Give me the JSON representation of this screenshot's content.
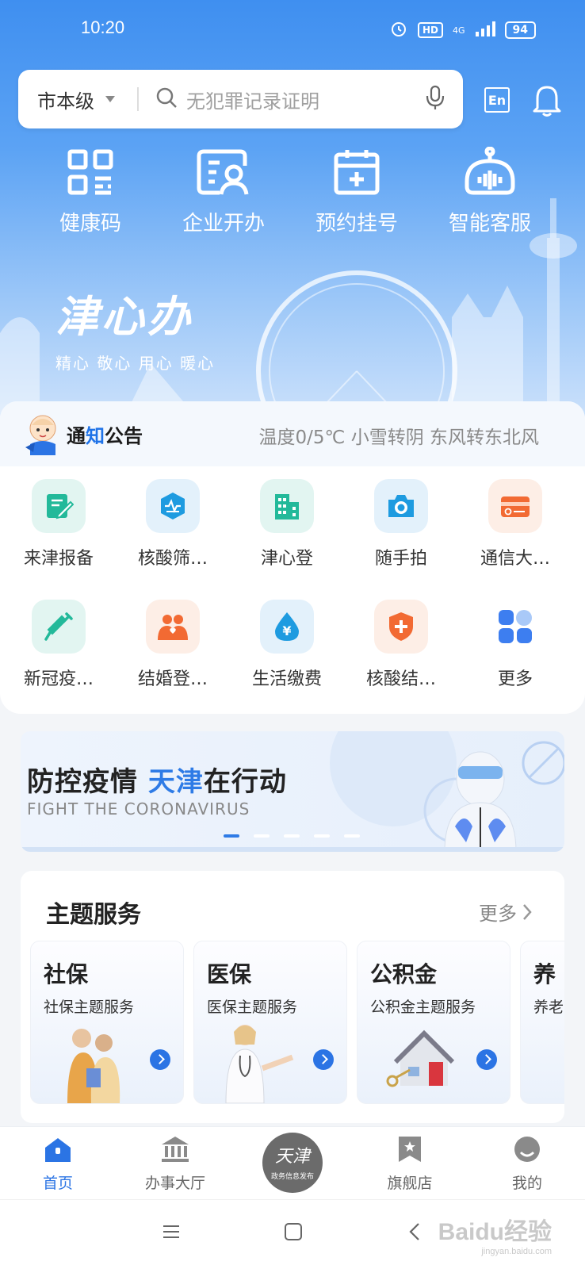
{
  "status_bar": {
    "time": "10:20",
    "hd": "HD",
    "network": "4G",
    "battery": "94"
  },
  "header": {
    "region": "市本级",
    "search_placeholder": "无犯罪记录证明",
    "lang_button": "En"
  },
  "quick_actions": [
    {
      "label": "健康码",
      "icon": "qr-code-icon"
    },
    {
      "label": "企业开办",
      "icon": "business-card-icon"
    },
    {
      "label": "预约挂号",
      "icon": "calendar-plus-icon"
    },
    {
      "label": "智能客服",
      "icon": "robot-icon"
    }
  ],
  "brand": {
    "logo": "津心办",
    "slogan": "精心 敬心 用心 暖心"
  },
  "notice": {
    "title_a": "通",
    "title_b": "知",
    "title_c": "公告",
    "weather": "温度0/5℃ 小雪转阴 东风转东北风"
  },
  "services": [
    {
      "label": "来津报备",
      "icon": "edit-form-icon",
      "bg": "#e2f5f1",
      "fg": "#23b99a"
    },
    {
      "label": "核酸筛…",
      "icon": "medical-test-icon",
      "bg": "#e3f1fb",
      "fg": "#1e9be0"
    },
    {
      "label": "津心登",
      "icon": "building-icon",
      "bg": "#e2f5f1",
      "fg": "#23b99a"
    },
    {
      "label": "随手拍",
      "icon": "camera-icon",
      "bg": "#e3f1fb",
      "fg": "#1e9be0"
    },
    {
      "label": "通信大…",
      "icon": "card-icon",
      "bg": "#fdeee6",
      "fg": "#f26a33"
    },
    {
      "label": "新冠疫…",
      "icon": "syringe-icon",
      "bg": "#e2f5f1",
      "fg": "#23b99a"
    },
    {
      "label": "结婚登…",
      "icon": "couple-icon",
      "bg": "#fdeee6",
      "fg": "#f26a33"
    },
    {
      "label": "生活缴费",
      "icon": "water-drop-yen-icon",
      "bg": "#e3f1fb",
      "fg": "#1e9be0"
    },
    {
      "label": "核酸结…",
      "icon": "shield-plus-icon",
      "bg": "#fdeee6",
      "fg": "#f26a33"
    },
    {
      "label": "更多",
      "icon": "grid-more-icon",
      "bg": "#ffffff",
      "fg": "#3d7ef0"
    }
  ],
  "banner": {
    "title_a": "防控疫情 ",
    "title_b": "天津",
    "title_c": "在行动",
    "subtitle": "FIGHT THE CORONAVIRUS",
    "active_slide": 1,
    "slide_count": 5
  },
  "topics": {
    "title": "主题服务",
    "more": "更多",
    "cards": [
      {
        "title": "社保",
        "desc": "社保主题服务"
      },
      {
        "title": "医保",
        "desc": "医保主题服务"
      },
      {
        "title": "公积金",
        "desc": "公积金主题服务"
      },
      {
        "title": "养",
        "desc": "养老"
      }
    ]
  },
  "tabs": [
    {
      "label": "首页",
      "icon": "home-icon",
      "active": true
    },
    {
      "label": "办事大厅",
      "icon": "government-hall-icon",
      "active": false
    },
    {
      "label": "旗舰店",
      "icon": "bookmark-star-icon",
      "active": false
    },
    {
      "label": "我的",
      "icon": "profile-icon",
      "active": false
    }
  ],
  "center_logo": {
    "main": "天津",
    "sub": "政务信息发布"
  },
  "watermark": {
    "main": "Baidu经验",
    "sub": "jingyan.baidu.com"
  },
  "colors": {
    "primary": "#2b74e4",
    "hero_top": "#3f8ff0"
  }
}
